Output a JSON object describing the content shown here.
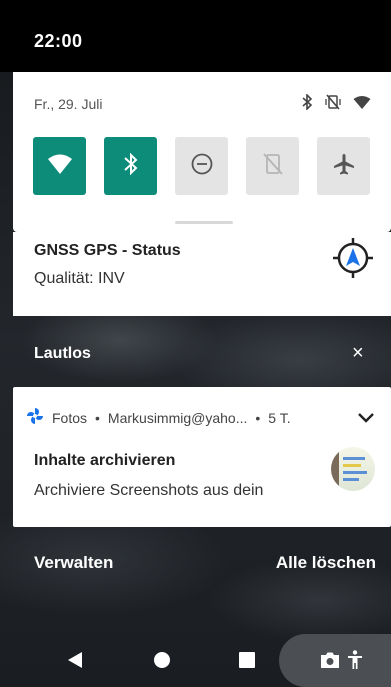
{
  "status_bar": {
    "time": "22:00"
  },
  "quick_settings": {
    "date": "Fr., 29. Juli",
    "status_icons": [
      "bluetooth-icon",
      "vibrate-off-icon",
      "wifi-icon"
    ],
    "tiles": [
      {
        "name": "wifi",
        "icon": "wifi-icon",
        "active": true
      },
      {
        "name": "bluetooth",
        "icon": "bluetooth-icon",
        "active": true
      },
      {
        "name": "do-not-disturb",
        "icon": "dnd-icon",
        "active": false
      },
      {
        "name": "auto-rotate",
        "icon": "rotate-icon",
        "active": false
      },
      {
        "name": "airplane-mode",
        "icon": "airplane-icon",
        "active": false
      }
    ]
  },
  "gnss_notification": {
    "title": "GNSS GPS - Status",
    "text": "Qualität: INV",
    "icon": "gps-compass-icon"
  },
  "silent_section": {
    "label": "Lautlos",
    "close": "×"
  },
  "fotos_notification": {
    "app": "Fotos",
    "account": "Markusimmig@yaho...",
    "age": "5 T.",
    "separator": "•",
    "title": "Inhalte archivieren",
    "text": "Archiviere Screenshots aus dein"
  },
  "actions": {
    "manage": "Verwalten",
    "clear_all": "Alle löschen"
  },
  "colors": {
    "accent": "#0e8c7a",
    "tile_off": "#e4e4e4",
    "gps_blue": "#1a73e8"
  },
  "nav_bar": {
    "items": [
      "back-icon",
      "home-icon",
      "recents-icon",
      "screenshot-icon",
      "accessibility-icon"
    ]
  }
}
